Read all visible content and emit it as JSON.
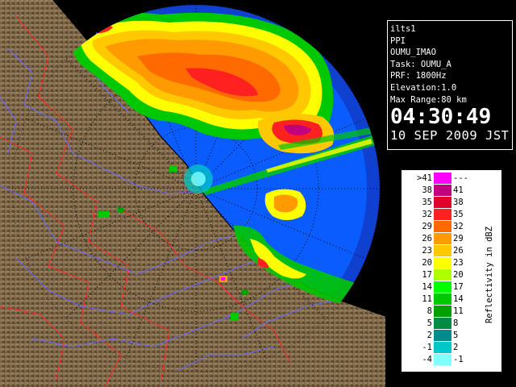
{
  "info": {
    "station": "ilts1",
    "mode": "PPI",
    "site": "OUMU_IMAO",
    "task": "Task: OUMU_A",
    "prf": "PRF: 1800Hz",
    "elevation": "Elevation:1.0",
    "max_range": "Max Range:80 km",
    "time": "04:30:49",
    "date": "10 SEP 2009 JST"
  },
  "legend": {
    "unit_label": "Reflectivity in dBZ",
    "rows": [
      {
        "lo": ">41",
        "hi": "---",
        "color": "#ff00ff"
      },
      {
        "lo": "38",
        "hi": "41",
        "color": "#c0007f"
      },
      {
        "lo": "35",
        "hi": "38",
        "color": "#e0002a"
      },
      {
        "lo": "32",
        "hi": "35",
        "color": "#ff2020"
      },
      {
        "lo": "29",
        "hi": "32",
        "color": "#ff6a00"
      },
      {
        "lo": "26",
        "hi": "29",
        "color": "#ff9a00"
      },
      {
        "lo": "23",
        "hi": "26",
        "color": "#ffc800"
      },
      {
        "lo": "20",
        "hi": "23",
        "color": "#ffff00"
      },
      {
        "lo": "17",
        "hi": "20",
        "color": "#b0ff00"
      },
      {
        "lo": "14",
        "hi": "17",
        "color": "#00ff00"
      },
      {
        "lo": "11",
        "hi": "14",
        "color": "#00c800"
      },
      {
        "lo": "8",
        "hi": "11",
        "color": "#00a000"
      },
      {
        "lo": "5",
        "hi": "8",
        "color": "#008c40"
      },
      {
        "lo": "2",
        "hi": "5",
        "color": "#008c8c"
      },
      {
        "lo": "-1",
        "hi": "2",
        "color": "#00c8c8"
      },
      {
        "lo": "-4",
        "hi": "-1",
        "color": "#80ffff"
      }
    ]
  },
  "map": {
    "sea_color": "#0a5cff",
    "outer_range_color": "#1040d0",
    "land_color": "#7a6446",
    "border_color": "#ff0000",
    "river_color": "#6060ff",
    "coast_color": "#000000",
    "range_ring_color": "#000000"
  }
}
